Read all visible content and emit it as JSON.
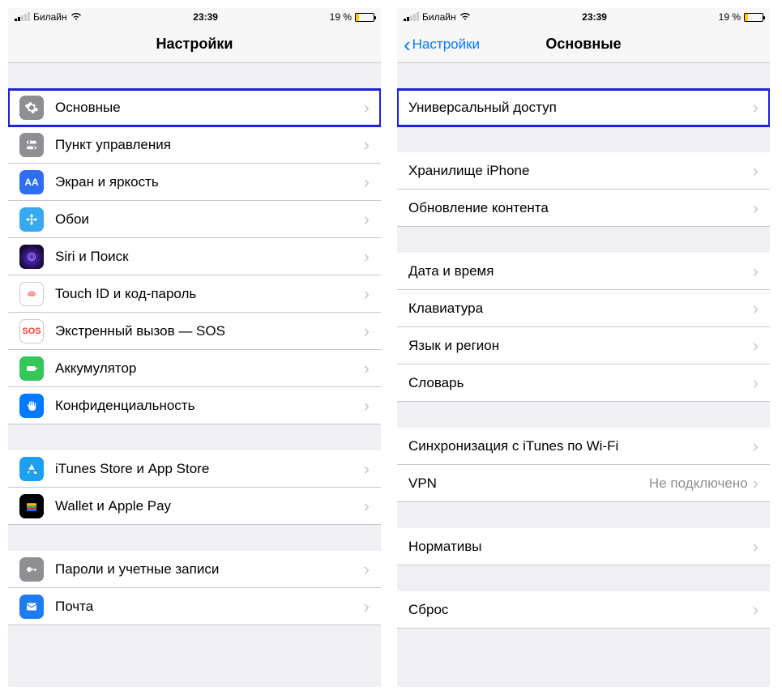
{
  "status": {
    "carrier": "Билайн",
    "time": "23:39",
    "battery_text": "19 %"
  },
  "left": {
    "nav_title": "Настройки",
    "rows": {
      "general": "Основные",
      "control_center": "Пункт управления",
      "display": "Экран и яркость",
      "wallpaper": "Обои",
      "siri": "Siri и Поиск",
      "touchid": "Touch ID и код-пароль",
      "sos": "Экстренный вызов — SOS",
      "battery": "Аккумулятор",
      "privacy": "Конфиденциальность",
      "appstore": "iTunes Store и App Store",
      "wallet": "Wallet и Apple Pay",
      "passwords": "Пароли и учетные записи",
      "mail": "Почта"
    }
  },
  "right": {
    "nav_back": "Настройки",
    "nav_title": "Основные",
    "rows": {
      "accessibility": "Универсальный доступ",
      "storage": "Хранилище iPhone",
      "background_refresh": "Обновление контента",
      "date_time": "Дата и время",
      "keyboard": "Клавиатура",
      "language_region": "Язык и регион",
      "dictionary": "Словарь",
      "itunes_wifi": "Синхронизация с iTunes по Wi-Fi",
      "vpn": "VPN",
      "vpn_value": "Не подключено",
      "regulatory": "Нормативы",
      "reset": "Сброс"
    }
  }
}
